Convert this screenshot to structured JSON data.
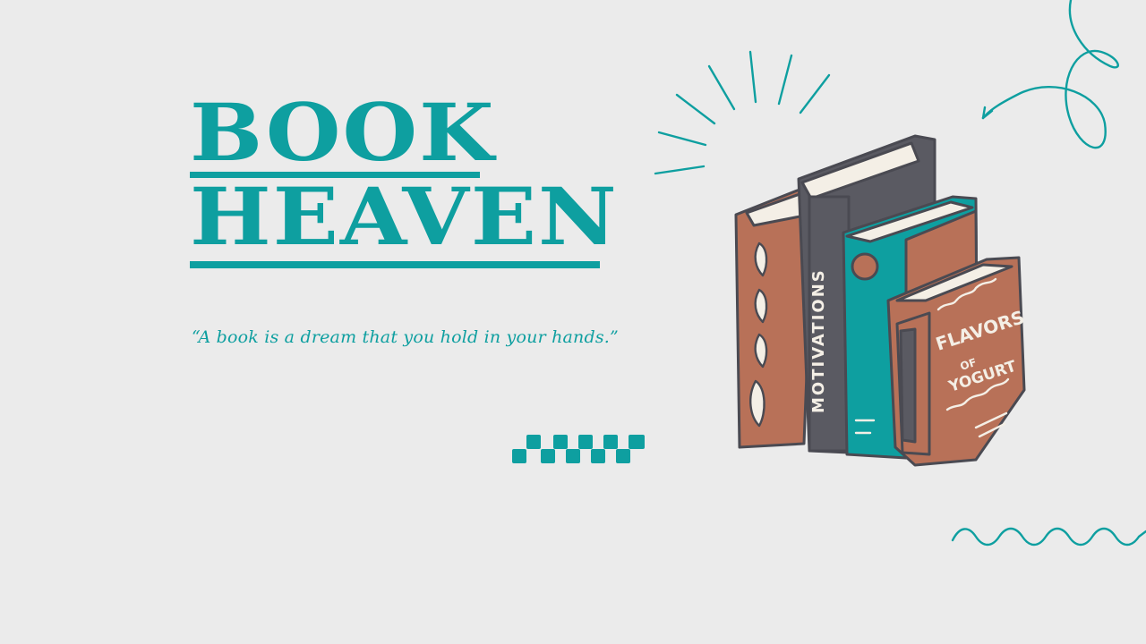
{
  "title": {
    "line1": "BOOK",
    "line2": "HEAVEN"
  },
  "quote": "“A book is a dream that you hold in your hands.”",
  "books": {
    "spine_left_book": "",
    "spine_dark_book": "MOTIVATIONS",
    "cover_front_book": "FLAVORS OF YOGURT"
  },
  "colors": {
    "background": "#ebebeb",
    "accent": "#0e9fa0",
    "book_brown": "#b87158",
    "book_dark": "#5a5a62",
    "outline": "#4a4a52",
    "page": "#f4efe6"
  }
}
